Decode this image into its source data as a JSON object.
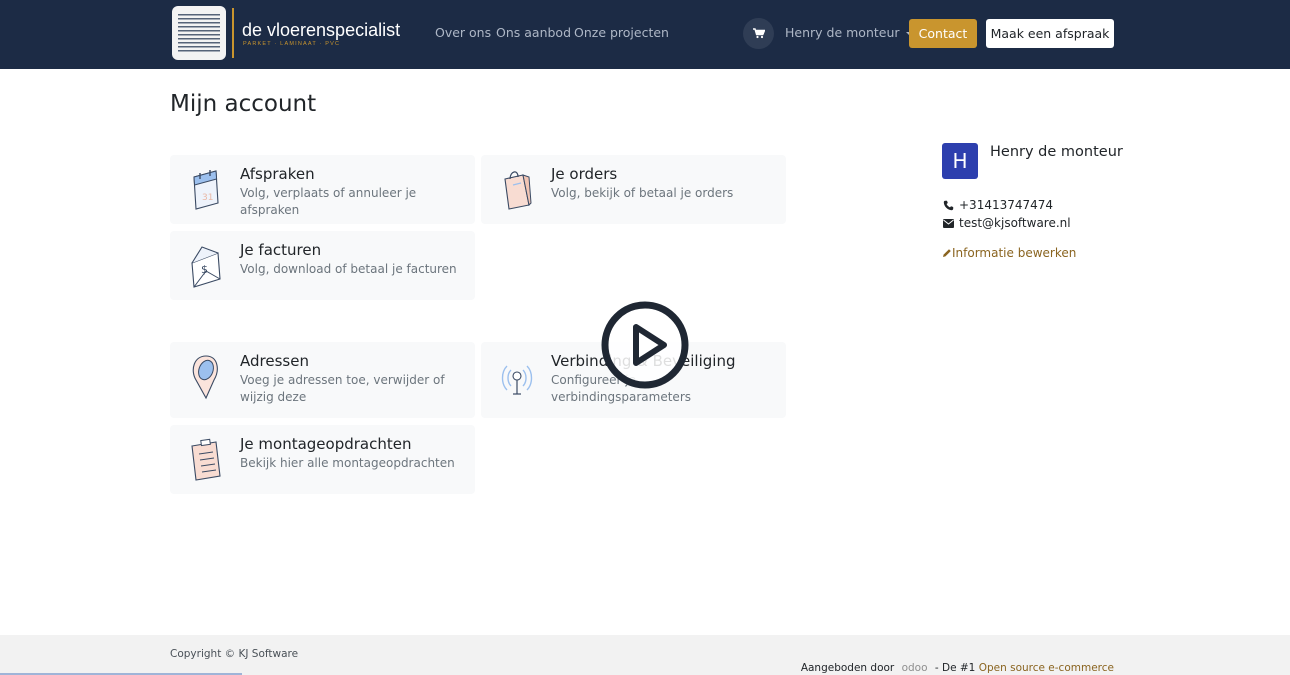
{
  "header": {
    "logo_title": "de vloerenspecialist",
    "logo_subtitle": "PARKET · LAMINAAT · PVC",
    "nav": [
      "Over ons",
      "Ons aanbod",
      "Onze projecten"
    ],
    "cart_icon": "cart-icon",
    "user_menu": "Henry de monteur",
    "contact_label": "Contact",
    "appointment_label": "Maak een afspraak",
    "colors": {
      "bar": "#1c2b45",
      "accent": "#c9952e"
    }
  },
  "page": {
    "title": "Mijn account"
  },
  "cards": [
    {
      "title": "Afspraken",
      "desc": "Volg, verplaats of annuleer je afspraken",
      "icon": "calendar-icon"
    },
    {
      "title": "Je orders",
      "desc": "Volg, bekijk of betaal je orders",
      "icon": "shopping-bag-icon"
    },
    {
      "title": "Je facturen",
      "desc": "Volg, download of betaal je facturen",
      "icon": "invoice-icon"
    },
    {
      "title": "Adressen",
      "desc": "Voeg je adressen toe, verwijder of wijzig deze",
      "icon": "map-pin-icon"
    },
    {
      "title": "Verbinding & Beveiliging",
      "desc": "Configureer je verbindingsparameters",
      "icon": "antenna-icon"
    },
    {
      "title": "Je montageopdrachten",
      "desc": "Bekijk hier alle montageopdrachten",
      "icon": "clipboard-icon"
    }
  ],
  "profile": {
    "initial": "H",
    "name": "Henry de monteur",
    "phone": "+31413747474",
    "email": "test@kjsoftware.nl",
    "edit_label": "Informatie bewerken"
  },
  "overlay": {
    "icon": "play-icon"
  },
  "footer": {
    "copyright": "Copyright © KJ Software",
    "powered_prefix": "Aangeboden door",
    "powered_brand": "odoo",
    "powered_mid": "- De #1",
    "powered_link": "Open source e-commerce"
  }
}
